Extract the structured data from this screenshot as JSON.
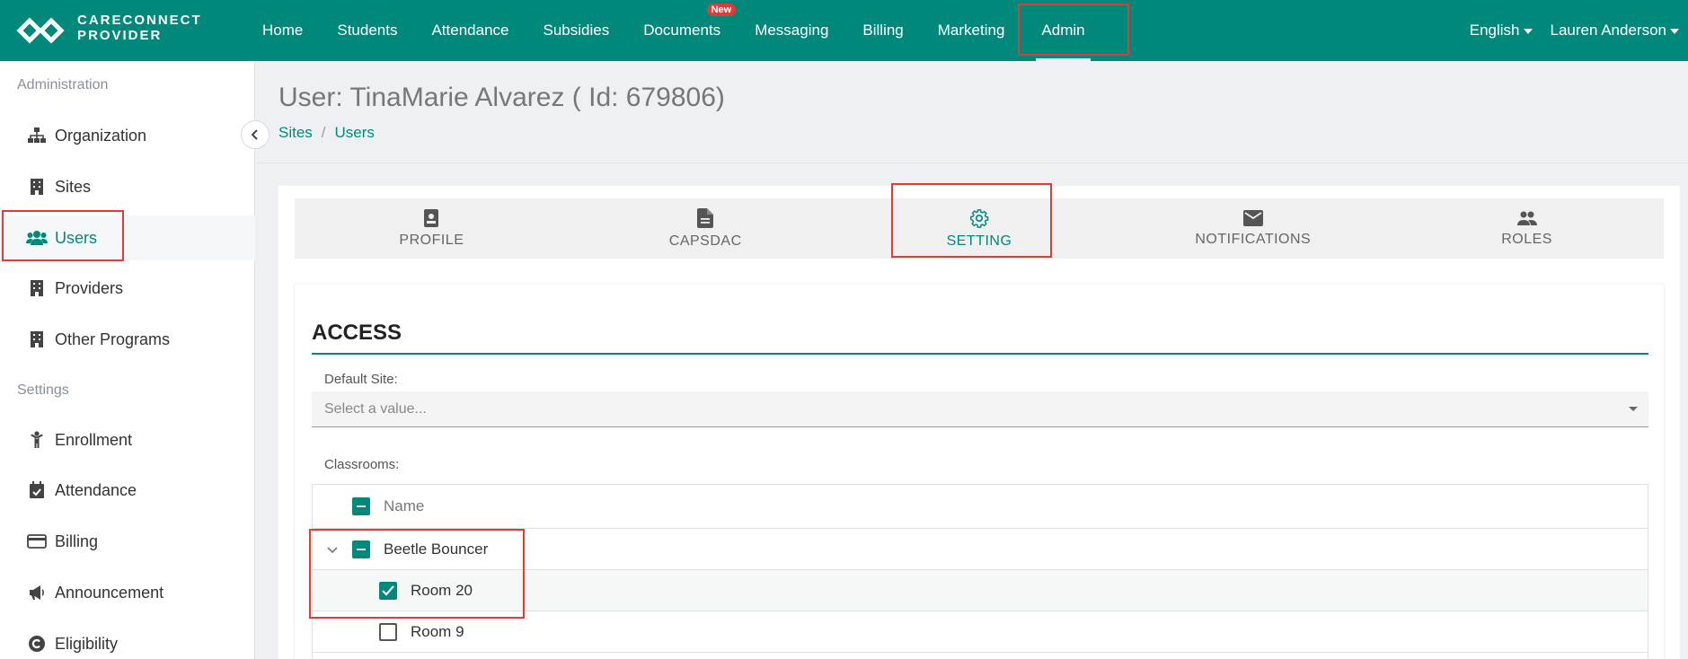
{
  "brand": {
    "line1": "CARECONNECT",
    "line2": "PROVIDER"
  },
  "nav": {
    "items": [
      {
        "label": "Home"
      },
      {
        "label": "Students"
      },
      {
        "label": "Attendance"
      },
      {
        "label": "Subsidies"
      },
      {
        "label": "Documents",
        "badge": "New"
      },
      {
        "label": "Messaging"
      },
      {
        "label": "Billing"
      },
      {
        "label": "Marketing"
      },
      {
        "label": "Admin",
        "active": true
      }
    ],
    "language": "English",
    "user": "Lauren Anderson"
  },
  "sidebar": {
    "sections": [
      {
        "title": "Administration",
        "items": [
          {
            "label": "Organization",
            "icon": "sitemap-icon"
          },
          {
            "label": "Sites",
            "icon": "building-icon"
          },
          {
            "label": "Users",
            "icon": "users-icon",
            "active": true
          },
          {
            "label": "Providers",
            "icon": "building-icon"
          },
          {
            "label": "Other Programs",
            "icon": "building-icon"
          }
        ]
      },
      {
        "title": "Settings",
        "items": [
          {
            "label": "Enrollment",
            "icon": "child-icon"
          },
          {
            "label": "Attendance",
            "icon": "calendar-check-icon"
          },
          {
            "label": "Billing",
            "icon": "credit-card-icon"
          },
          {
            "label": "Announcement",
            "icon": "megaphone-icon"
          },
          {
            "label": "Eligibility",
            "icon": "copyright-icon"
          }
        ]
      }
    ]
  },
  "page": {
    "title": "User: TinaMarie Alvarez ( Id: 679806)",
    "breadcrumb": [
      "Sites",
      "Users"
    ]
  },
  "tabs": [
    {
      "label": "PROFILE",
      "icon": "id-badge-icon"
    },
    {
      "label": "CAPSDAC",
      "icon": "document-icon"
    },
    {
      "label": "SETTING",
      "icon": "gear-icon",
      "active": true
    },
    {
      "label": "NOTIFICATIONS",
      "icon": "envelope-icon"
    },
    {
      "label": "ROLES",
      "icon": "people-icon"
    }
  ],
  "access": {
    "title": "ACCESS",
    "default_site_label": "Default Site:",
    "default_site_placeholder": "Select a value...",
    "classrooms_label": "Classrooms:",
    "tree_header": "Name",
    "tree": [
      {
        "label": "Beetle Bouncer",
        "state": "partial",
        "expanded": true
      },
      {
        "label": "Room 20",
        "state": "checked"
      },
      {
        "label": "Room 9",
        "state": "unchecked"
      }
    ]
  },
  "colors": {
    "primary": "#00897b",
    "highlight": "#e53935",
    "badge": "#e53935"
  }
}
